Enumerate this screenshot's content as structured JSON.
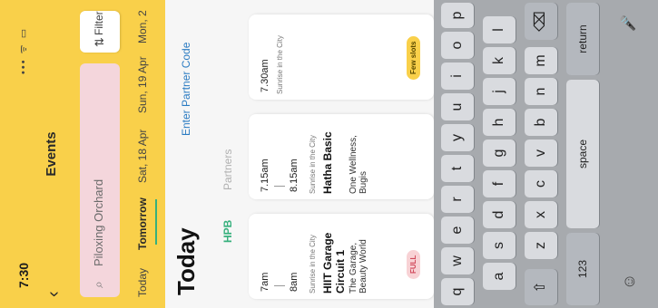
{
  "status_bar": {
    "time": "7:30",
    "icons": "••• ᯤ ▭"
  },
  "header": {
    "back_icon": "chevron-left-icon",
    "title": "Events",
    "search_placeholder": "Piloxing Orchard",
    "filter_label": "Filter",
    "accent_color": "#f9d04a"
  },
  "dates": [
    {
      "label": "Today",
      "selected": false
    },
    {
      "label": "Tomorrow",
      "selected": true
    },
    {
      "label": "Sat, 18 Apr",
      "selected": false
    },
    {
      "label": "Sun, 19 Apr",
      "selected": false
    },
    {
      "label": "Mon, 2",
      "selected": false
    }
  ],
  "main": {
    "heading": "Today",
    "partner_code_link": "Enter Partner Code",
    "tabs": [
      {
        "label": "HPB",
        "active": true
      },
      {
        "label": "Partners",
        "active": false
      }
    ]
  },
  "events": [
    {
      "start": "7am",
      "end": "8am",
      "location": "Sunrise in the City",
      "name": "HIIT Garage Circuit 1",
      "venue": "The Garage, Beauty World",
      "badge": "FULL"
    },
    {
      "start": "7.15am",
      "end": "8.15am",
      "location": "Sunrise in the City",
      "name": "Hatha Basic",
      "venue": "One Wellness, Bugis",
      "badge": ""
    },
    {
      "start": "7.30am",
      "end": "",
      "location": "Sunrise in the City",
      "name": "",
      "venue": "",
      "badge": "Few slots"
    }
  ],
  "keyboard": {
    "row1": [
      "q",
      "w",
      "e",
      "r",
      "t",
      "y",
      "u",
      "i",
      "o",
      "p"
    ],
    "row2": [
      "a",
      "s",
      "d",
      "f",
      "g",
      "h",
      "j",
      "k",
      "l"
    ],
    "row3": [
      "z",
      "x",
      "c",
      "v",
      "b",
      "n",
      "m"
    ],
    "shift_icon": "shift-icon",
    "backspace_icon": "backspace-icon",
    "numbers_label": "123",
    "space_label": "space",
    "return_label": "return",
    "emoji_icon": "emoji-icon",
    "mic_icon": "microphone-icon"
  }
}
